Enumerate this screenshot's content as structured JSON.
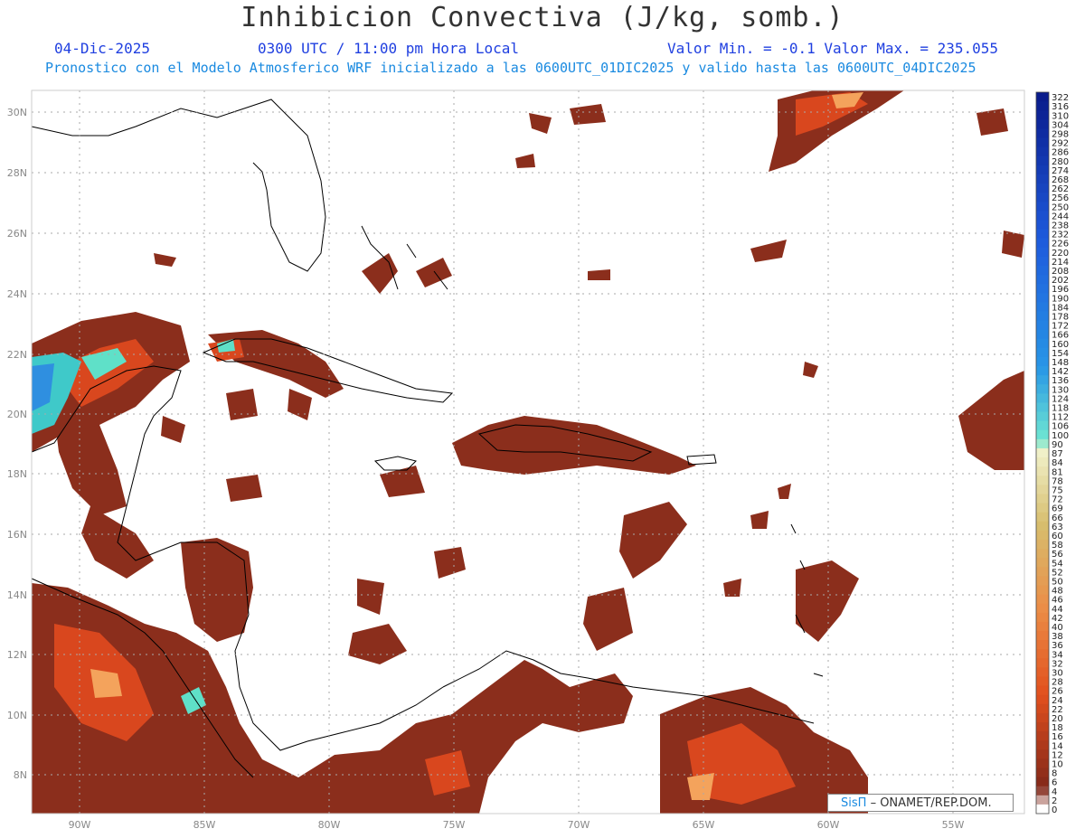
{
  "header": {
    "title": "Inhibicion Convectiva (J/kg, somb.)",
    "date": "04-Dic-2025",
    "time": "0300 UTC / 11:00 pm Hora Local",
    "minmax": "Valor Min. = -0.1  Valor Max. = 235.055",
    "description": "Pronostico con el Modelo Atmosferico WRF inicializado a las 0600UTC_01DIC2025 y valido hasta las  0600UTC_04DIC2025"
  },
  "axes": {
    "lon_labels": [
      "90W",
      "85W",
      "80W",
      "75W",
      "70W",
      "65W",
      "60W",
      "55W"
    ],
    "lat_labels": [
      "30N",
      "28N",
      "26N",
      "24N",
      "22N",
      "20N",
      "18N",
      "16N",
      "14N",
      "12N",
      "10N",
      "8N"
    ]
  },
  "colorbar": {
    "labels": [
      "322",
      "316",
      "310",
      "304",
      "298",
      "292",
      "286",
      "280",
      "274",
      "268",
      "262",
      "256",
      "250",
      "244",
      "238",
      "232",
      "226",
      "220",
      "214",
      "208",
      "202",
      "196",
      "190",
      "184",
      "178",
      "172",
      "166",
      "160",
      "154",
      "148",
      "142",
      "136",
      "130",
      "124",
      "118",
      "112",
      "106",
      "100",
      "90",
      "87",
      "84",
      "81",
      "78",
      "75",
      "72",
      "69",
      "66",
      "63",
      "60",
      "58",
      "56",
      "54",
      "52",
      "50",
      "48",
      "46",
      "44",
      "42",
      "40",
      "38",
      "36",
      "34",
      "32",
      "30",
      "28",
      "26",
      "24",
      "22",
      "20",
      "18",
      "16",
      "14",
      "12",
      "10",
      "8",
      "6",
      "4",
      "2",
      "0"
    ]
  },
  "credit": {
    "brand": "SisΠ",
    "text": "– ONAMET/REP.DOM."
  },
  "colors": {
    "low": "#8b2e1c",
    "mid": "#e8551e",
    "high": "#f6a060",
    "teal": "#40e0d0",
    "blue": "#0a1c8c"
  }
}
